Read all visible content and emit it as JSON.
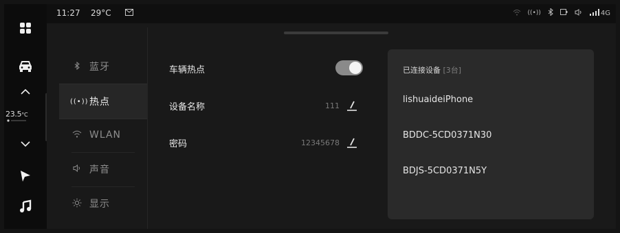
{
  "status_bar": {
    "time": "11:27",
    "temperature": "29°C",
    "network": "4G"
  },
  "rail": {
    "cabin_temp": "23.5",
    "cabin_temp_unit": "°C"
  },
  "menu": {
    "items": [
      {
        "icon": "bluetooth-icon",
        "glyph": "∗",
        "label": "蓝牙"
      },
      {
        "icon": "hotspot-icon",
        "glyph": "((•))",
        "label": "热点"
      },
      {
        "icon": "wifi-icon",
        "glyph": "≋",
        "label": "WLAN"
      },
      {
        "icon": "speaker-icon",
        "glyph": "◁)",
        "label": "声音"
      },
      {
        "icon": "sun-icon",
        "glyph": "☼",
        "label": "显示"
      }
    ],
    "active_index": 1
  },
  "hotspot": {
    "toggle_label": "车辆热点",
    "toggle_on": true,
    "device_name_label": "设备名称",
    "device_name_value": "111",
    "password_label": "密码",
    "password_value": "12345678"
  },
  "connected": {
    "title": "已连接设备",
    "count": "[3台]",
    "devices": [
      "lishuaideiPhone",
      "BDDC-5CD0371N30",
      "BDJS-5CD0371N5Y"
    ]
  },
  "colors": {
    "background": "#191919",
    "panel": "#2a2a2a",
    "toggle_track": "#8a8a8a",
    "toggle_knob": "#f4f4f4"
  }
}
